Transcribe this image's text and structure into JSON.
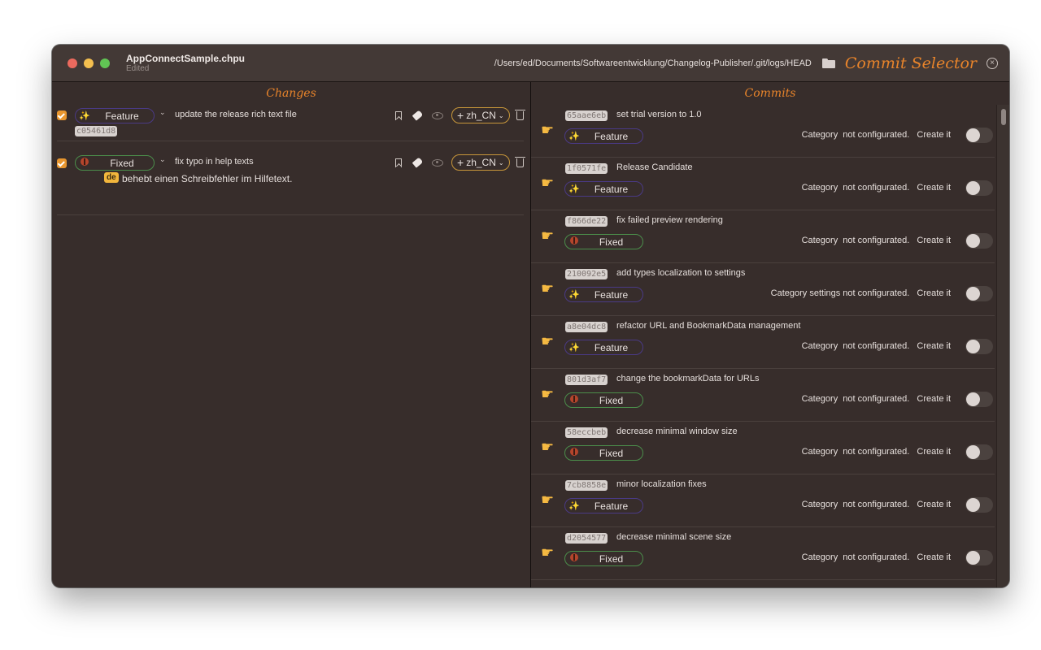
{
  "window": {
    "doc_name": "AppConnectSample.chpu",
    "doc_status": "Edited",
    "path": "/Users/ed/Documents/Softwareentwicklung/Changelog-Publisher/.git/logs/HEAD",
    "title": "Commit Selector",
    "close_glyph": "×"
  },
  "changes": {
    "title": "Changes",
    "items": [
      {
        "checked": true,
        "category": "Feature",
        "message": "update the release rich text file",
        "hash": "c05461d8",
        "language": "zh_CN"
      },
      {
        "checked": true,
        "category": "Fixed",
        "message": "fix typo in help texts",
        "translation_lang": "de",
        "translation": "behebt einen Schreibfehler im Hilfetext.",
        "language": "zh_CN"
      }
    ]
  },
  "commits": {
    "title": "Commits",
    "items": [
      {
        "hash": "65aae6eb",
        "message": "set trial version to 1.0",
        "category": "Feature",
        "status": "Category  not configurated.",
        "create_label": "Create it",
        "enabled": false
      },
      {
        "hash": "1f0571fe",
        "message": "Release Candidate",
        "category": "Feature",
        "status": "Category  not configurated.",
        "create_label": "Create it",
        "enabled": false
      },
      {
        "hash": "f866de22",
        "message": "fix failed preview rendering",
        "category": "Fixed",
        "status": "Category  not configurated.",
        "create_label": "Create it",
        "enabled": false
      },
      {
        "hash": "210092e5",
        "message": " add types localization to settings",
        "category": "Feature",
        "status": "Category settings not configurated.",
        "create_label": "Create it",
        "enabled": false
      },
      {
        "hash": "a8e04dc8",
        "message": "refactor URL and BookmarkData management",
        "category": "Feature",
        "status": "Category  not configurated.",
        "create_label": "Create it",
        "enabled": false
      },
      {
        "hash": "801d3af7",
        "message": "change the bookmarkData for URLs",
        "category": "Fixed",
        "status": "Category  not configurated.",
        "create_label": "Create it",
        "enabled": false
      },
      {
        "hash": "58eccbeb",
        "message": "decrease minimal window size",
        "category": "Fixed",
        "status": "Category  not configurated.",
        "create_label": "Create it",
        "enabled": false
      },
      {
        "hash": "7cb8858e",
        "message": "minor localization fixes",
        "category": "Feature",
        "status": "Category  not configurated.",
        "create_label": "Create it",
        "enabled": false
      },
      {
        "hash": "d2054577",
        "message": "decrease minimal scene size",
        "category": "Fixed",
        "status": "Category  not configurated.",
        "create_label": "Create it",
        "enabled": false
      }
    ]
  },
  "icons": {
    "feature": "✨",
    "hand": "☛",
    "plus": "+",
    "chevron": "⌄"
  },
  "colors": {
    "accent": "#e8842b",
    "feature_border": "#4a3a86",
    "fixed_border": "#4b8e4b",
    "language_border": "#c8973a",
    "checkbox": "#e8962f"
  }
}
